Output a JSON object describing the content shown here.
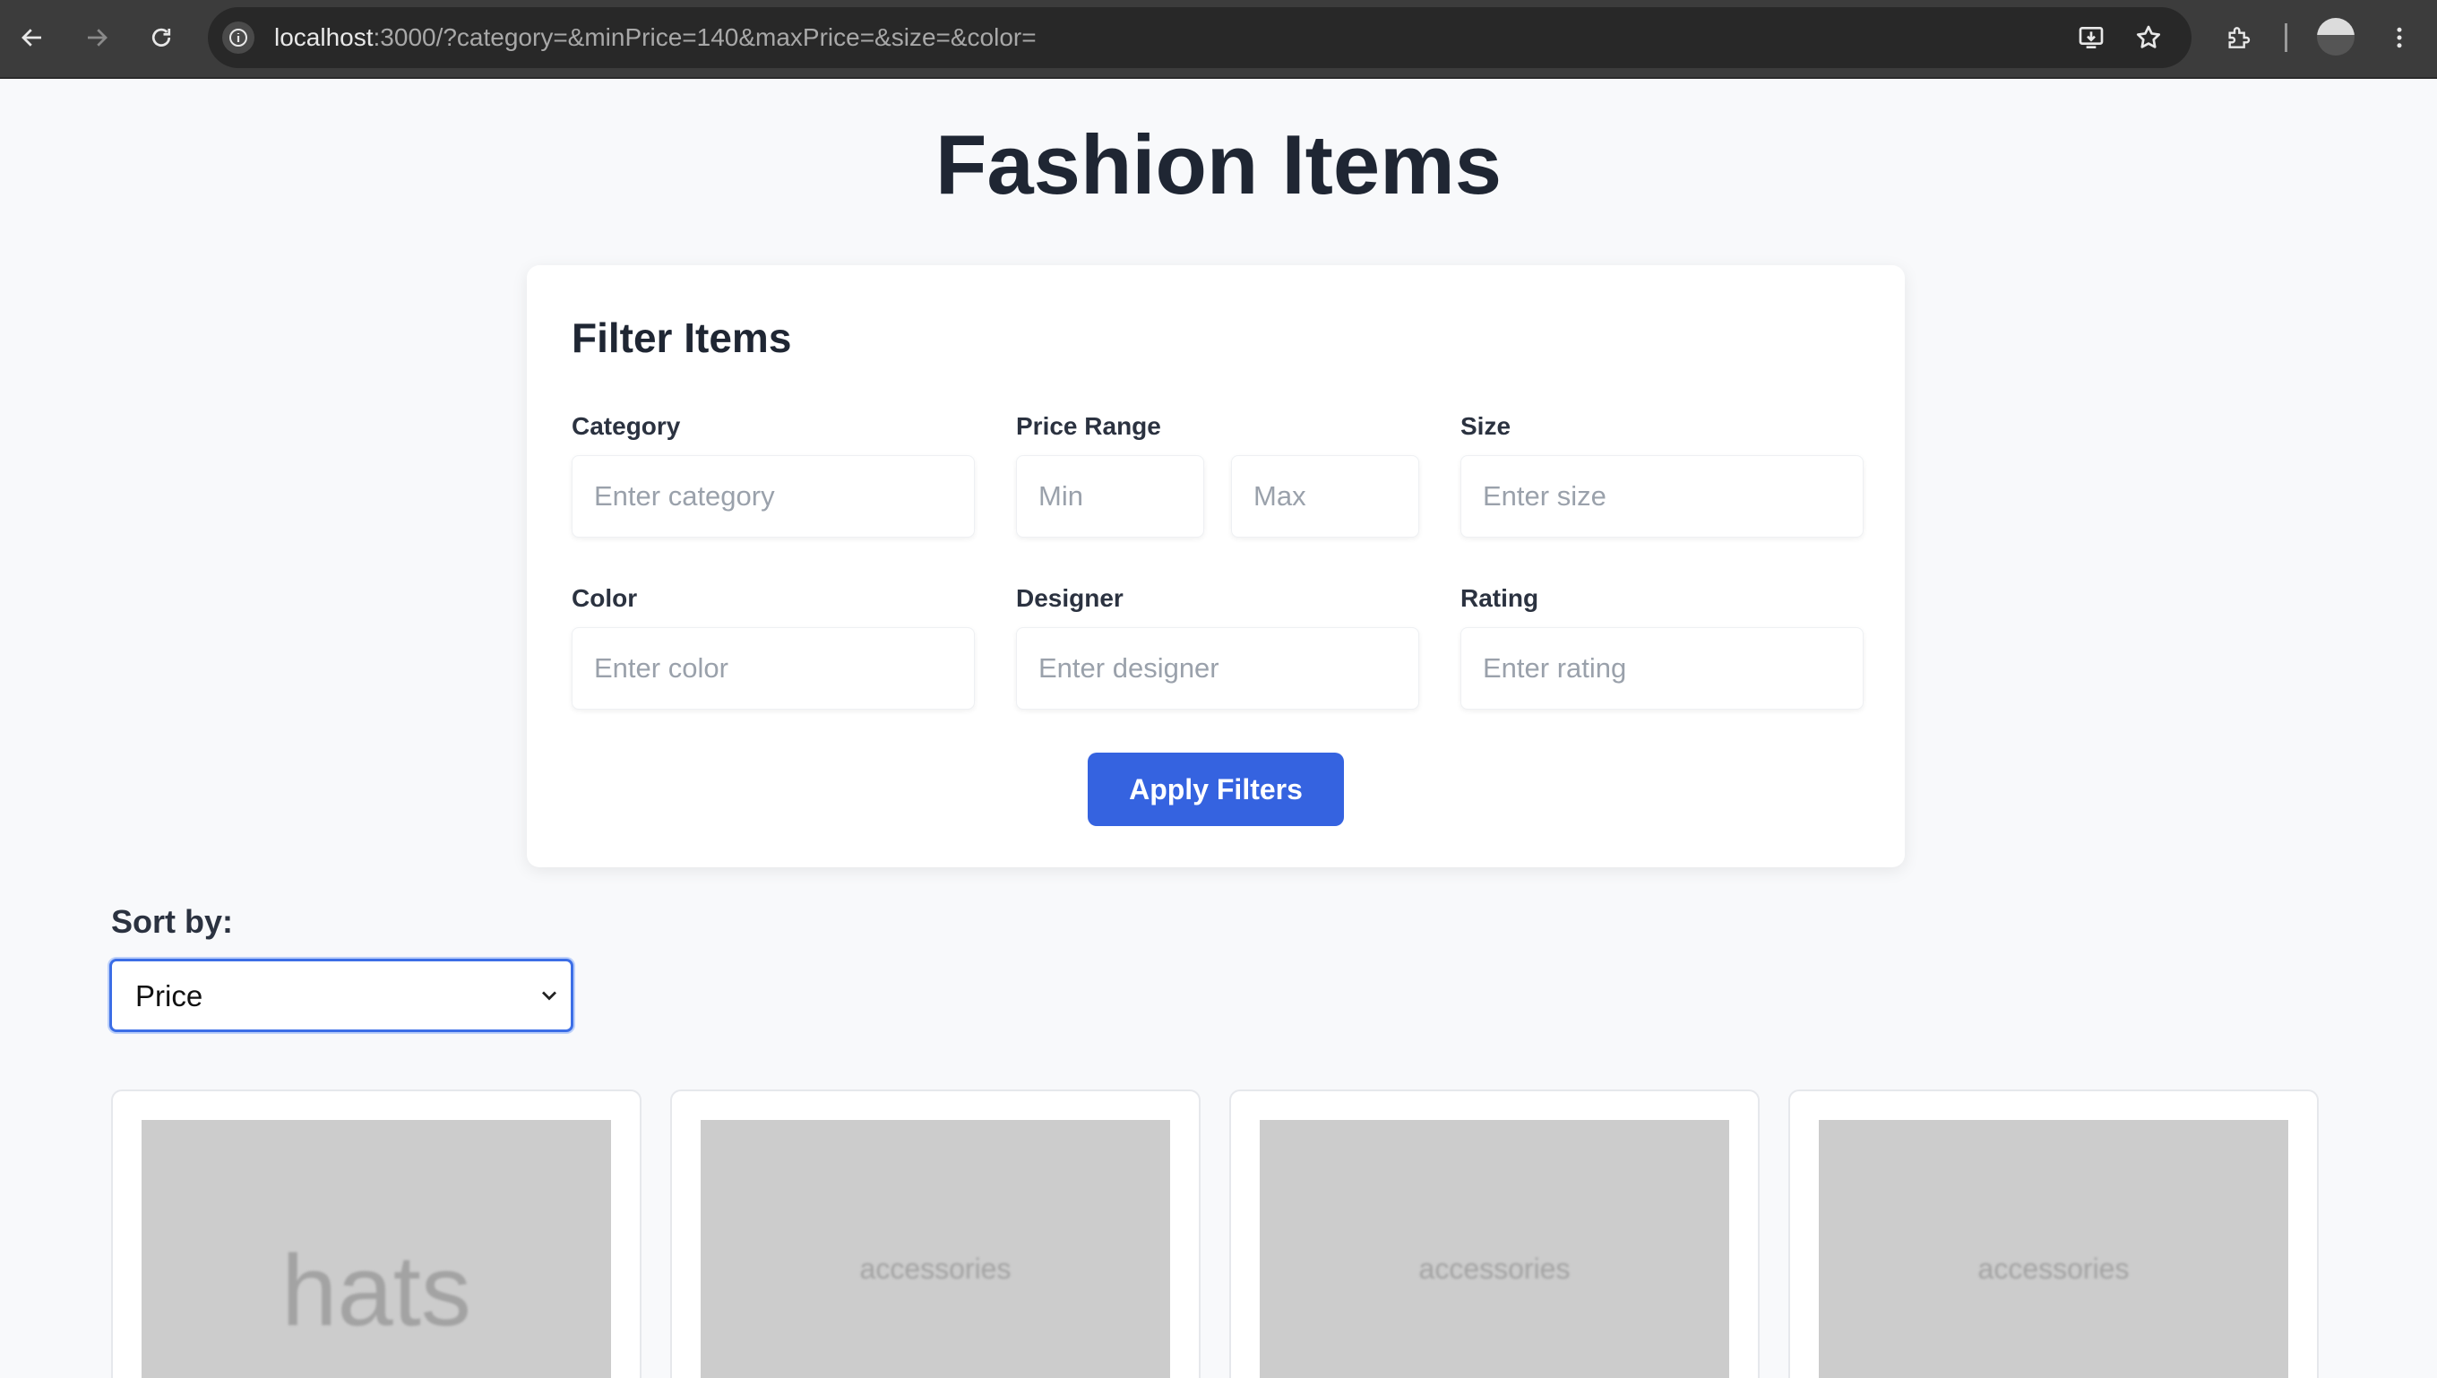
{
  "browser": {
    "url_host": "localhost",
    "url_rest": ":3000/?category=&minPrice=140&maxPrice=&size=&color="
  },
  "page": {
    "title": "Fashion Items"
  },
  "filter": {
    "title": "Filter Items",
    "category_label": "Category",
    "category_placeholder": "Enter category",
    "price_label": "Price Range",
    "min_placeholder": "Min",
    "max_placeholder": "Max",
    "size_label": "Size",
    "size_placeholder": "Enter size",
    "color_label": "Color",
    "color_placeholder": "Enter color",
    "designer_label": "Designer",
    "designer_placeholder": "Enter designer",
    "rating_label": "Rating",
    "rating_placeholder": "Enter rating",
    "apply_label": "Apply Filters"
  },
  "sort": {
    "label": "Sort by:",
    "selected": "Price"
  },
  "items": [
    {
      "image_text": "hats"
    },
    {
      "image_text": "accessories"
    },
    {
      "image_text": "accessories"
    },
    {
      "image_text": "accessories"
    }
  ],
  "colors": {
    "accent": "#3563e0",
    "heading": "#1f2633",
    "placeholder_bg": "#cccccc"
  }
}
